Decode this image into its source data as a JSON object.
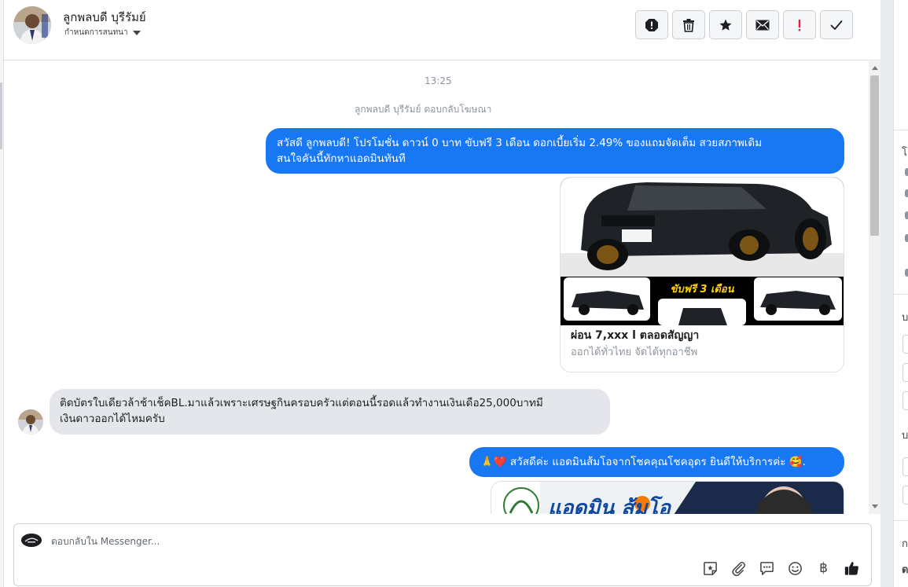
{
  "header": {
    "name": "ลูกพลบดี บุรีรัมย์",
    "subtitle": "กำหนดการสนทนา"
  },
  "conversation": {
    "timestamp": "13:25",
    "reply_note": "ลูกพลบดี บุรีรัมย์ ตอบกลับโฆษณา",
    "messages": [
      {
        "direction": "outgoing",
        "text_line1": "สวัสดี ลูกพลบดี! โปรโมชั่น ดาวน์ 0 บาท ขับฟรี 3 เดือน ดอกเบี้ยเริ่ม 2.49% ของแถมจัดเต็ม สวยสภาพเดิม",
        "text_line2": "สนใจคันนี้ทักหาแอดมินทันที"
      },
      {
        "direction": "incoming",
        "text_line1": "ติดบัตรใบเดียวล้าช้าเช็คBL.มาแล้วเพราะเศรษฐกินครอบครัวแต่ตอนนี้รอดแล้วทำงานเงินเดือ25,000บาทมี",
        "text_line2": "เงินดาวออกได้ไหมครับ"
      },
      {
        "direction": "outgoing",
        "text": "🙏❤️ สวัสดีค่ะ แอดมินส้มโอจากโชคคุณโชคอุดร ยินดีให้บริการค่ะ 🥰."
      }
    ],
    "ad_card": {
      "overlay_text": "ขับฟรี 3 เดือน",
      "title": "ผ่อน 7,xxx l ตลอดสัญญา",
      "subtitle": "ออกได้ทั่วไทย จัดได้ทุกอาชีพ"
    },
    "ad_card_2": {
      "overlay_text": "แอดมิน ส้มโอ"
    }
  },
  "composer": {
    "placeholder": "ตอบกลับใน Messenger...",
    "baht_symbol": "฿"
  },
  "colors": {
    "outgoing_bubble": "#1877f2",
    "incoming_bubble": "#e4e6eb",
    "alert_red": "#e41e3f"
  },
  "icons": [
    "spam-report-icon",
    "trash-icon",
    "star-icon",
    "envelope-icon",
    "exclamation-icon",
    "checkmark-icon",
    "sticker-icon",
    "paperclip-icon",
    "saved-reply-icon",
    "emoji-icon",
    "baht-icon",
    "thumbs-up-icon"
  ]
}
